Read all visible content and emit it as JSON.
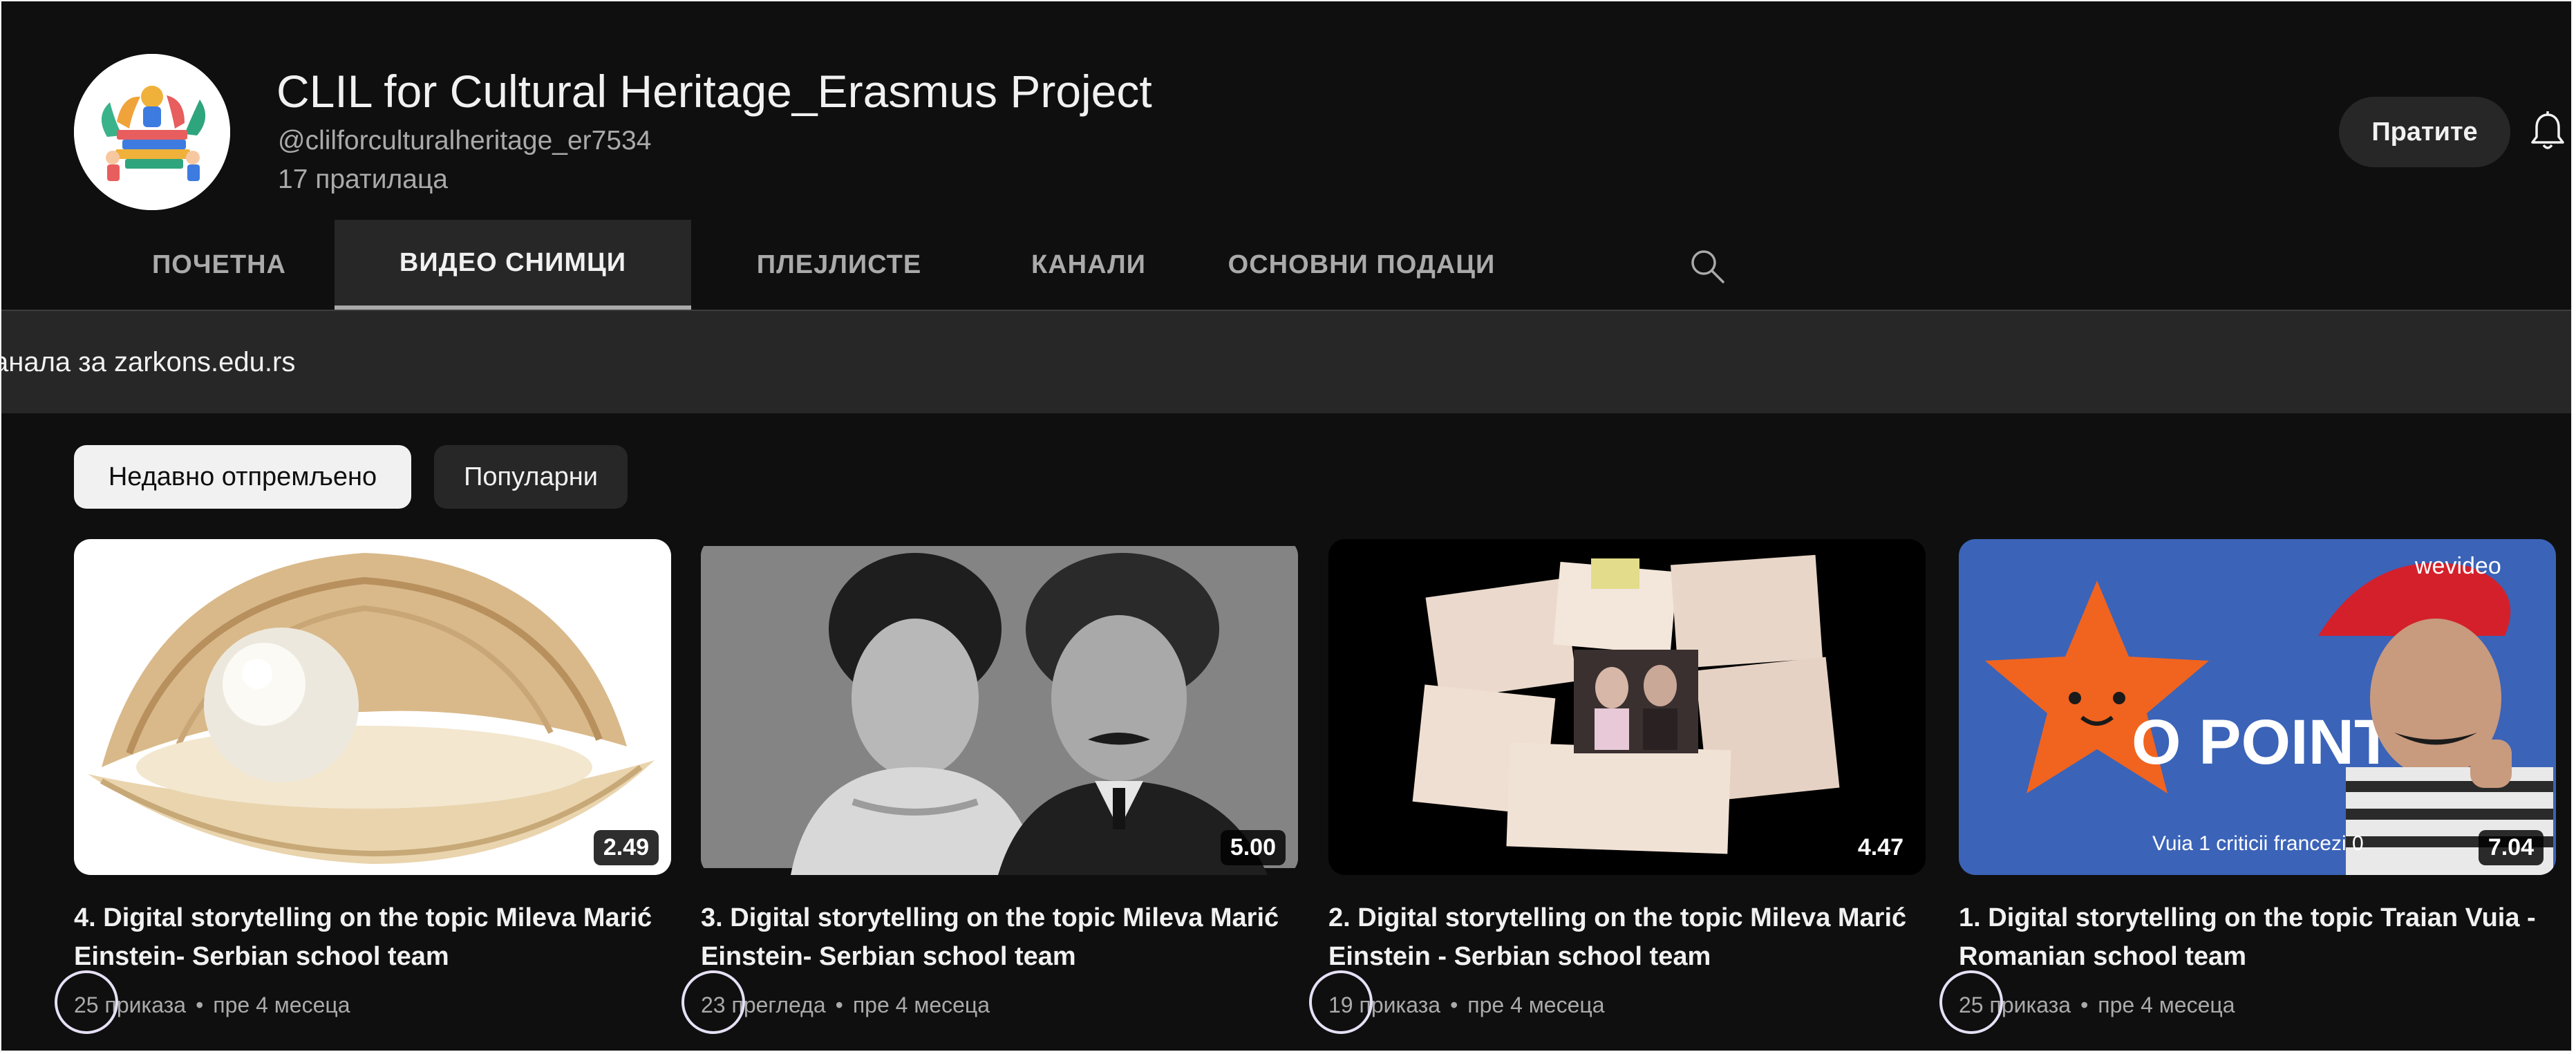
{
  "channel": {
    "title": "CLIL for Cultural Heritage_Erasmus Project",
    "handle": "@clilforculturalheritage_er7534",
    "subscribers": "17 пратилаца",
    "subscribe_label": "Пратите"
  },
  "tabs": [
    {
      "label": "ПОЧЕТНА",
      "active": false
    },
    {
      "label": "ВИДЕО СНИМЦИ",
      "active": true
    },
    {
      "label": "ПЛЕЈЛИСТЕ",
      "active": false
    },
    {
      "label": "КАНАЛИ",
      "active": false
    },
    {
      "label": "ОСНОВНИ ПОДАЦИ",
      "active": false
    }
  ],
  "banner": {
    "text": "анала за zarkons.edu.rs"
  },
  "chips": [
    {
      "label": "Недавно отпремљено",
      "selected": true
    },
    {
      "label": "Популарни",
      "selected": false
    }
  ],
  "videos": [
    {
      "title": "4. Digital storytelling on the topic Mileva Marić Einstein- Serbian school team",
      "duration": "2.49",
      "views": "25 приказа",
      "age": "пре 4 месеца",
      "thumb": "pearl-shell"
    },
    {
      "title": "3. Digital storytelling on the topic Mileva Marić Einstein- Serbian school team",
      "duration": "5.00",
      "views": "23 прегледа",
      "age": "пре 4 месеца",
      "thumb": "couple-photo"
    },
    {
      "title": "2. Digital storytelling on the topic Mileva Marić Einstein - Serbian school team",
      "duration": "4.47",
      "views": "19 приказа",
      "age": "пре 4 месеца",
      "thumb": "letters-collage"
    },
    {
      "title": "1. Digital storytelling on the topic Traian Vuia - Romanian school team",
      "duration": "7.04",
      "views": "25 приказа",
      "age": "пре 4 месеца",
      "thumb": "star-point",
      "thumb_text": "O POINT",
      "thumb_brand": "wevideo",
      "thumb_caption": "Vuia 1 criticii francezi 0"
    }
  ],
  "colors": {
    "background": "#0f0f0f",
    "surface": "#272727",
    "text": "#f1f1f1",
    "muted": "#aaaaaa"
  },
  "separator": "•"
}
